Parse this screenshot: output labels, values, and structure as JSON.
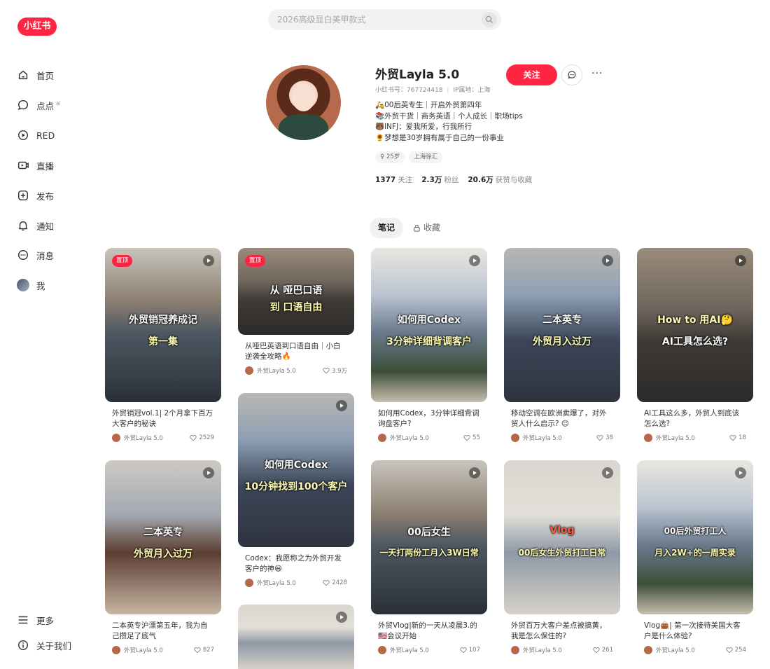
{
  "brand": {
    "logo_text": "小红书",
    "accent": "#ff2442"
  },
  "search": {
    "placeholder": "2026高级显白美甲款式"
  },
  "sidebar": {
    "items": [
      {
        "label": "首页",
        "icon": "home-icon"
      },
      {
        "label": "点点",
        "icon": "chat-bubble-icon",
        "badge": "ai"
      },
      {
        "label": "RED",
        "icon": "play-circle-icon"
      },
      {
        "label": "直播",
        "icon": "live-icon"
      },
      {
        "label": "发布",
        "icon": "plus-square-icon"
      },
      {
        "label": "通知",
        "icon": "bell-icon"
      },
      {
        "label": "消息",
        "icon": "message-icon"
      },
      {
        "label": "我",
        "icon": "avatar"
      }
    ],
    "bottom": [
      {
        "label": "更多",
        "icon": "menu-icon"
      },
      {
        "label": "关于我们",
        "icon": "info-icon"
      }
    ]
  },
  "profile": {
    "name": "外贸Layla 5.0",
    "id_text": "小红书号：767724418",
    "ip_text": "IP属地：上海",
    "follow_label": "关注",
    "bio": [
      "🛵00后英专生｜开启外贸第四年",
      "📚外贸干货｜商务英语｜个人成长｜职场tips",
      "🐻INFJ：爱我所爱，行我所行",
      "🌻梦想是30岁拥有属于自己的一份事业"
    ],
    "tags": [
      "♀ 25岁",
      "上海徐汇"
    ],
    "stats": [
      {
        "num": "1377",
        "label": "关注"
      },
      {
        "num": "2.3万",
        "label": "粉丝"
      },
      {
        "num": "20.6万",
        "label": "获赞与收藏"
      }
    ]
  },
  "tabs": {
    "notes": "笔记",
    "favorites": "收藏"
  },
  "notes": [
    {
      "title": "外贸销冠vol.1| 2个月拿下百万大客户的秘诀",
      "author": "外贸Layla 5.0",
      "likes": "2529",
      "pinned": "置顶",
      "cover1": "外贸销冠养成记",
      "cover2": "第一集"
    },
    {
      "title": "从哑巴英语到口语自由｜小白逆袭全攻略🔥",
      "author": "外贸Layla 5.0",
      "likes": "3.9万",
      "pinned": "置顶",
      "cover1": "从 哑巴口语",
      "cover2": "到 口语自由"
    },
    {
      "title": "如何用Codex，3分钟详细背调询盘客户?",
      "author": "外贸Layla 5.0",
      "likes": "55",
      "cover1": "如何用Codex",
      "cover2": "3分钟详细背调客户"
    },
    {
      "title": "移动空调在欧洲卖爆了，对外贸人什么启示? 😊",
      "author": "外贸Layla 5.0",
      "likes": "38",
      "cover1": "二本英专",
      "cover2": "外贸月入过万"
    },
    {
      "title": "AI工具这么多，外贸人到底该怎么选?",
      "author": "外贸Layla 5.0",
      "likes": "18",
      "cover1": "How to 用AI🤔",
      "cover2": "AI工具怎么选?"
    },
    {
      "title": "二本英专沪漂第五年，我为自己攒足了底气",
      "author": "外贸Layla 5.0",
      "likes": "827",
      "cover1": "二本英专",
      "cover2": "外贸月入过万"
    },
    {
      "title": "Codex：我愿称之为外贸开发客户的神😆",
      "author": "外贸Layla 5.0",
      "likes": "2428",
      "cover1": "如何用Codex",
      "cover2": "10分钟找到100个客户"
    },
    {
      "title": "外贸Vlog|新的一天从凌晨3.的🇺🇸会议开始",
      "author": "外贸Layla 5.0",
      "likes": "107",
      "cover1": "00后女生",
      "cover2": "一天打两份工月入3W日常"
    },
    {
      "title": "外贸百万大客户差点被搞黄，我是怎么保住的?",
      "author": "外贸Layla 5.0",
      "likes": "261",
      "cover1": "Vlog",
      "cover2": "00后女生外贸打工日常"
    },
    {
      "title": "Vlog👜| 第一次接待美国大客户是什么体验?",
      "author": "外贸Layla 5.0",
      "likes": "254",
      "cover1": "00后外贸打工人",
      "cover2": "月入2W+的一周实录"
    }
  ]
}
